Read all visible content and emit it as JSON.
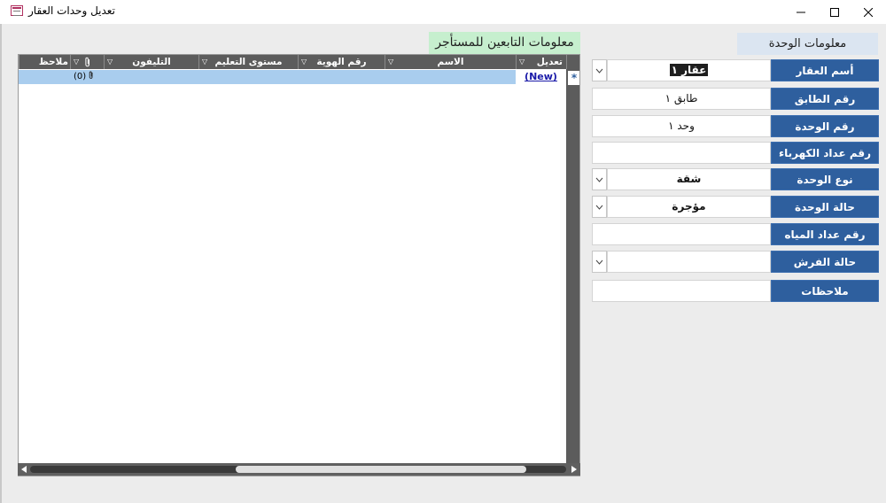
{
  "window": {
    "title": "تعديل وحدات العقار",
    "icons": {
      "app": "form-icon",
      "minimize": "minimize-icon",
      "maximize": "maximize-icon",
      "close": "close-icon"
    }
  },
  "unit_info": {
    "header": "معلومات الوحدة",
    "fields": [
      {
        "label": "أسم العقار",
        "value": "عقار ١",
        "type": "combo"
      },
      {
        "label": "رقم الطابق",
        "value": "طابق ١",
        "type": "text"
      },
      {
        "label": "رقم الوحدة",
        "value": "وحد ١",
        "type": "text"
      },
      {
        "label": "رقم عداد الكهرباء",
        "value": "",
        "type": "text"
      },
      {
        "label": "نوع الوحدة",
        "value": "شقة",
        "type": "combo"
      },
      {
        "label": "حالة الوحدة",
        "value": "مؤجرة",
        "type": "combo"
      },
      {
        "label": "رقم عداد المياه",
        "value": "",
        "type": "text"
      },
      {
        "label": "حالة الفرش",
        "value": "",
        "type": "combo"
      },
      {
        "label": "ملاحظات",
        "value": "",
        "type": "text"
      }
    ]
  },
  "dependents": {
    "header": "معلومات التابعين للمستأجر",
    "columns": [
      "تعديل",
      "الاسم",
      "رقم الهوية",
      "مستوى التعليم",
      "التليفون",
      "",
      "ملاحظ"
    ],
    "new_row": {
      "marker": "*",
      "edit_link": "(New)",
      "attachments": "(0)"
    }
  },
  "colors": {
    "label_bg": "#2e5f9e",
    "unit_header_bg": "#dbe5f1",
    "dependents_header_bg": "#c6efce",
    "column_header_bg": "#5c5c5c",
    "new_row_bg": "#a9cdee"
  }
}
